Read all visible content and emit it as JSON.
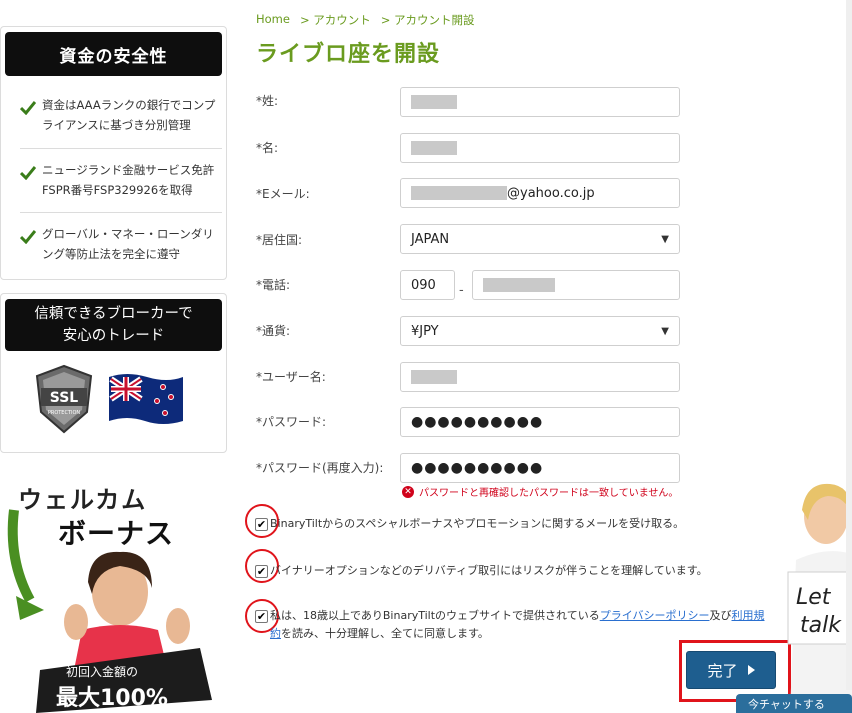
{
  "breadcrumb": {
    "home": "Home",
    "account": "> アカウント",
    "open": "> アカウント開設"
  },
  "title": "ライブロ座を開設",
  "sidebar": {
    "safety_title": "資金の安全性",
    "features": [
      "資金はAAAランクの銀行でコンプライアンスに基づき分別管理",
      "ニュージランド金融サービス免許FSPR番号FSP329926を取得",
      "グローバル・マネー・ローンダリング等防止法を完全に遵守"
    ],
    "trust_line1": "信頼できるブローカーで",
    "trust_line2": "安心のトレード",
    "ssl_text": "SSL",
    "ssl_sub": "PROTECTION",
    "promo_line1": "ウェルカム",
    "promo_line2": "ボーナス",
    "promo_line3": "初回入金額の",
    "promo_line4": "最大100%"
  },
  "form": {
    "last_name_label": "*姓:",
    "first_name_label": "*名:",
    "email_label": "*Eメール:",
    "email_suffix": "@yahoo.co.jp",
    "country_label": "*居住国:",
    "country_value": "JAPAN",
    "phone_label": "*電話:",
    "phone_prefix": "090",
    "phone_dash": "-",
    "currency_label": "*通貨:",
    "currency_value": "¥JPY",
    "username_label": "*ユーザー名:",
    "password_label": "*パスワード:",
    "password_value": "●●●●●●●●●●",
    "password_confirm_label": "*パスワード(再度入力):",
    "password_confirm_value": "●●●●●●●●●●",
    "error_text": "パスワードと再確認したパスワードは一致していません。",
    "check1_text": "BinaryTiltからのスペシャルボーナスやプロモーションに関するメールを受け取る。",
    "check2_text": "バイナリーオプションなどのデリバティブ取引にはリスクが伴うことを理解しています。",
    "check3_pre": "私は、18歳以上でありBinaryTiltのウェブサイトで提供されている",
    "check3_link1": "プライバシーポリシー",
    "check3_mid": "及び",
    "check3_link2a": "利用規",
    "check3_link2b": "約",
    "check3_post": "を読み、十分理解し、全てに同意します。",
    "check_mark": "✔",
    "submit_label": "完了"
  },
  "chat": {
    "sign_line1": "Let",
    "sign_line2": "talk",
    "bar_label": "今チャットする"
  },
  "colors": {
    "accent_green": "#6a9b1f",
    "button_blue": "#1e5e8f",
    "error_red": "#d0021b",
    "highlight_red": "#e0141b"
  }
}
